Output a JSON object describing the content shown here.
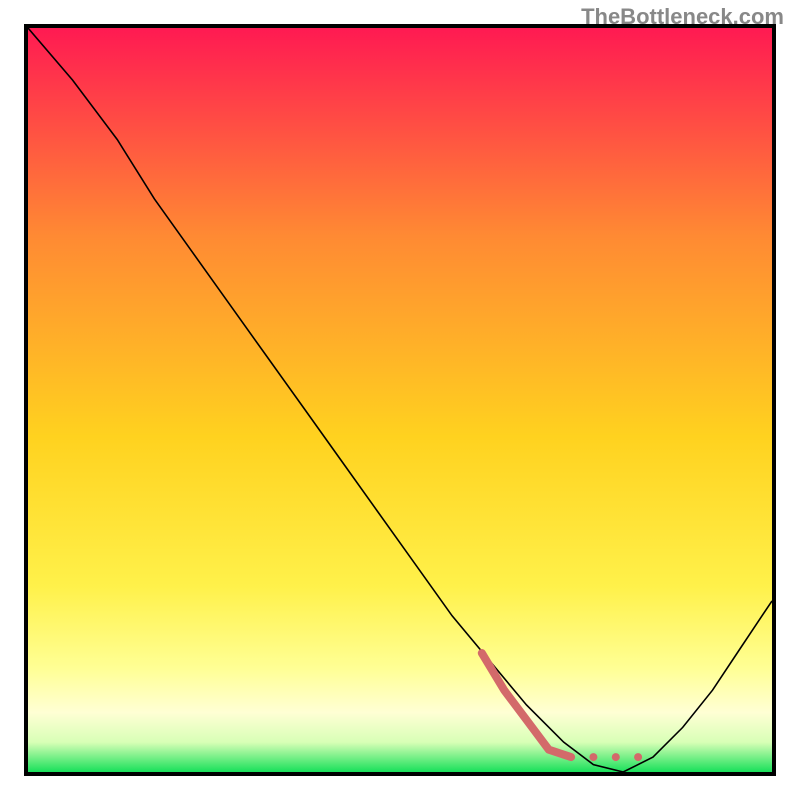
{
  "watermark": "TheBottleneck.com",
  "chart_data": {
    "type": "line",
    "title": "",
    "xlabel": "",
    "ylabel": "",
    "xlim": [
      0,
      100
    ],
    "ylim": [
      0,
      100
    ],
    "gradient": {
      "top_color": "#ff1a52",
      "upper_mid_color": "#ff8a33",
      "mid_color": "#ffd21f",
      "lower_mid1_color": "#fff14a",
      "lower_mid2_color": "#ffff94",
      "pale_yellow_color": "#ffffd4",
      "near_bottom_color": "#d8ffb6",
      "bottom_color": "#18e05a"
    },
    "series": [
      {
        "name": "main-curve",
        "color": "#000000",
        "stroke_width": 1.6,
        "points": [
          {
            "x": 0,
            "y": 100
          },
          {
            "x": 6,
            "y": 93
          },
          {
            "x": 12,
            "y": 85
          },
          {
            "x": 17,
            "y": 77
          },
          {
            "x": 22,
            "y": 70
          },
          {
            "x": 27,
            "y": 63
          },
          {
            "x": 32,
            "y": 56
          },
          {
            "x": 37,
            "y": 49
          },
          {
            "x": 42,
            "y": 42
          },
          {
            "x": 47,
            "y": 35
          },
          {
            "x": 52,
            "y": 28
          },
          {
            "x": 57,
            "y": 21
          },
          {
            "x": 62,
            "y": 15
          },
          {
            "x": 67,
            "y": 9
          },
          {
            "x": 72,
            "y": 4
          },
          {
            "x": 76,
            "y": 1
          },
          {
            "x": 80,
            "y": 0
          },
          {
            "x": 84,
            "y": 2
          },
          {
            "x": 88,
            "y": 6
          },
          {
            "x": 92,
            "y": 11
          },
          {
            "x": 96,
            "y": 17
          },
          {
            "x": 100,
            "y": 23
          }
        ]
      },
      {
        "name": "highlight-segment",
        "color": "#d36a6a",
        "stroke_width": 8,
        "style": "dashed_tail",
        "points": [
          {
            "x": 61,
            "y": 16
          },
          {
            "x": 64,
            "y": 11
          },
          {
            "x": 67,
            "y": 7
          },
          {
            "x": 70,
            "y": 3
          },
          {
            "x": 73,
            "y": 2
          },
          {
            "x": 76,
            "y": 2
          },
          {
            "x": 79,
            "y": 2
          },
          {
            "x": 82,
            "y": 2
          }
        ]
      }
    ]
  }
}
